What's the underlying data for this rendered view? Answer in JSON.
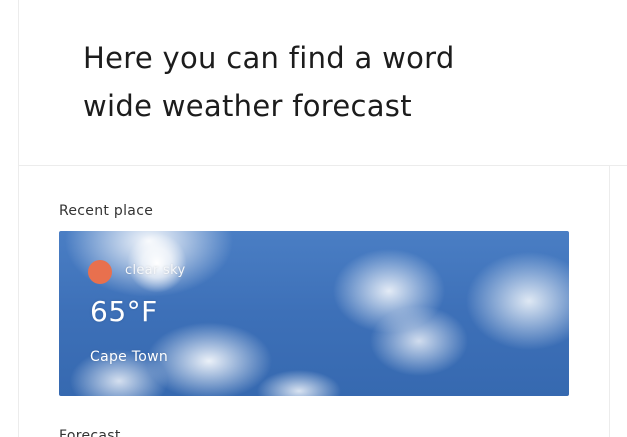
{
  "hero": {
    "title": "Here you can find a word wide weather forecast"
  },
  "recent": {
    "label": "Recent place",
    "card": {
      "condition": "clear sky",
      "temperature": "65°F",
      "city": "Cape Town",
      "status_color": "#e8704e",
      "background_image": "blue-sky-with-clouds"
    }
  },
  "next_section": {
    "label": "Forecast"
  },
  "colors": {
    "text_dark": "#1c1c1c",
    "border": "#ececec",
    "sky_blue": "#3d70b8",
    "accent_orange": "#e8704e"
  }
}
